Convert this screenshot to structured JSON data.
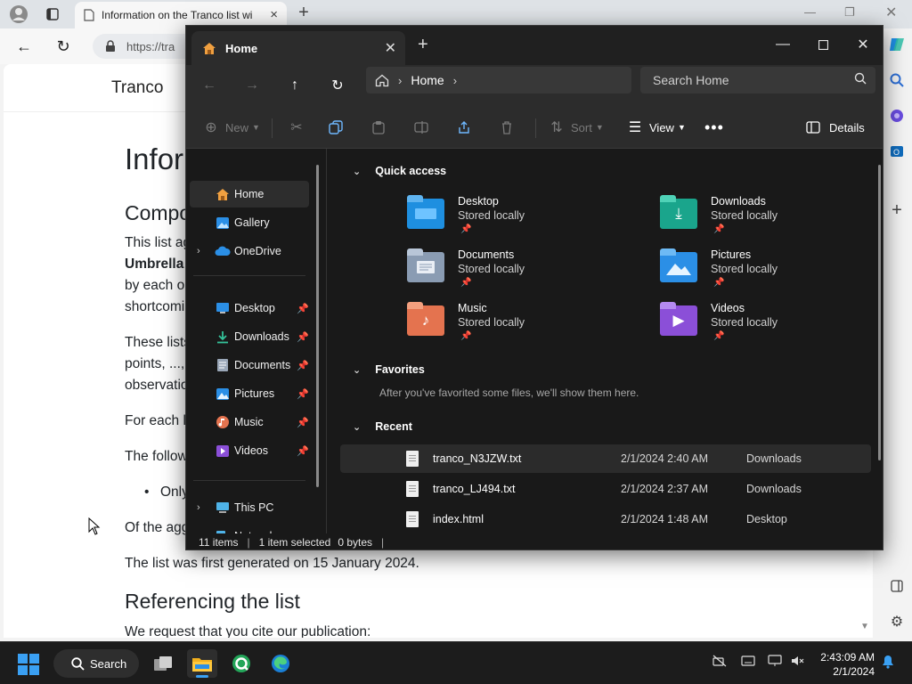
{
  "browser": {
    "tab_title": "Information on the Tranco list wi",
    "address": "https://tra",
    "site_brand": "Tranco",
    "page": {
      "h1": "Infor",
      "h2_components": "Compo",
      "p1_line1": "This list ag",
      "p1_line2": "Umbrella",
      "p1_line3": "by each o",
      "p1_line4": "shortcomi",
      "p2_line1": "These lists",
      "p2_line2": "points, ...,",
      "p2_line3": "observatio",
      "p3": "For each l",
      "p4": "The follow",
      "bullet": "Only",
      "p5": "Of the agg",
      "p6": "The list was first generated on 15 January 2024.",
      "h2_referencing": "Referencing the list",
      "p7": "We request that you cite our publication:"
    }
  },
  "explorer": {
    "tab_label": "Home",
    "breadcrumb": "Home",
    "search_placeholder": "Search Home",
    "commands": {
      "new": "New",
      "sort": "Sort",
      "view": "View",
      "details": "Details"
    },
    "nav_pane": [
      {
        "label": "Home",
        "icon": "home-icon"
      },
      {
        "label": "Gallery",
        "icon": "gallery-icon"
      },
      {
        "label": "OneDrive",
        "icon": "cloud-icon"
      },
      {
        "label": "Desktop",
        "icon": "desktop-icon"
      },
      {
        "label": "Downloads",
        "icon": "download-icon"
      },
      {
        "label": "Documents",
        "icon": "document-icon"
      },
      {
        "label": "Pictures",
        "icon": "picture-icon"
      },
      {
        "label": "Music",
        "icon": "music-icon"
      },
      {
        "label": "Videos",
        "icon": "video-icon"
      },
      {
        "label": "This PC",
        "icon": "computer-icon"
      },
      {
        "label": "Network",
        "icon": "network-icon"
      }
    ],
    "quick_access_header": "Quick access",
    "quick_access": [
      {
        "name": "Desktop",
        "sub": "Stored locally",
        "color": "#1e8fe0"
      },
      {
        "name": "Downloads",
        "sub": "Stored locally",
        "color": "#1aa58c"
      },
      {
        "name": "Documents",
        "sub": "Stored locally",
        "color": "#8a9cb3"
      },
      {
        "name": "Pictures",
        "sub": "Stored locally",
        "color": "#2b8fe6"
      },
      {
        "name": "Music",
        "sub": "Stored locally",
        "color": "#e4734f"
      },
      {
        "name": "Videos",
        "sub": "Stored locally",
        "color": "#8b4fd8"
      }
    ],
    "favorites_header": "Favorites",
    "favorites_hint": "After you've favorited some files, we'll show them here.",
    "recent_header": "Recent",
    "recent": [
      {
        "name": "tranco_N3JZW.txt",
        "date": "2/1/2024 2:40 AM",
        "location": "Downloads"
      },
      {
        "name": "tranco_LJ494.txt",
        "date": "2/1/2024 2:37 AM",
        "location": "Downloads"
      },
      {
        "name": "index.html",
        "date": "2/1/2024 1:48 AM",
        "location": "Desktop"
      }
    ],
    "status": {
      "items": "11 items",
      "selected": "1 item selected",
      "size": "0 bytes"
    }
  },
  "taskbar": {
    "search_label": "Search",
    "time": "2:43:09 AM",
    "date": "2/1/2024"
  }
}
